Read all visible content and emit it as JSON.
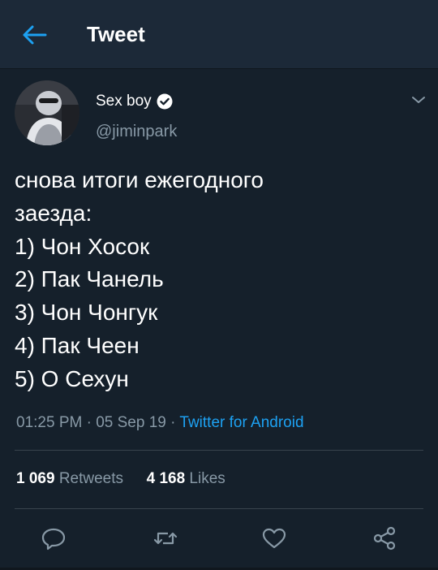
{
  "header": {
    "title": "Tweet",
    "back_icon": "arrow-left-icon"
  },
  "author": {
    "display_name": "Sex boy",
    "handle": "@jiminpark",
    "verified": true
  },
  "tweet": {
    "lines": [
      "снова итоги ежегодного",
      "заезда:",
      "1) Чон Хосок",
      "2) Пак Чанель",
      "3) Чон Чонгук",
      "4) Пак Чеен",
      "5) О Сехун"
    ]
  },
  "meta": {
    "time": "01:25 PM",
    "separator": "·",
    "date": "05 Sep 19",
    "source": "Twitter for Android"
  },
  "stats": {
    "retweets_count": "1 069",
    "retweets_label": "Retweets",
    "likes_count": "4 168",
    "likes_label": "Likes"
  },
  "actions": [
    "reply-icon",
    "retweet-icon",
    "like-icon",
    "share-icon"
  ],
  "colors": {
    "background": "#15202b",
    "header": "#1c2938",
    "accent": "#1da1f2",
    "secondary_text": "#8899a6",
    "divider": "#38444d"
  }
}
